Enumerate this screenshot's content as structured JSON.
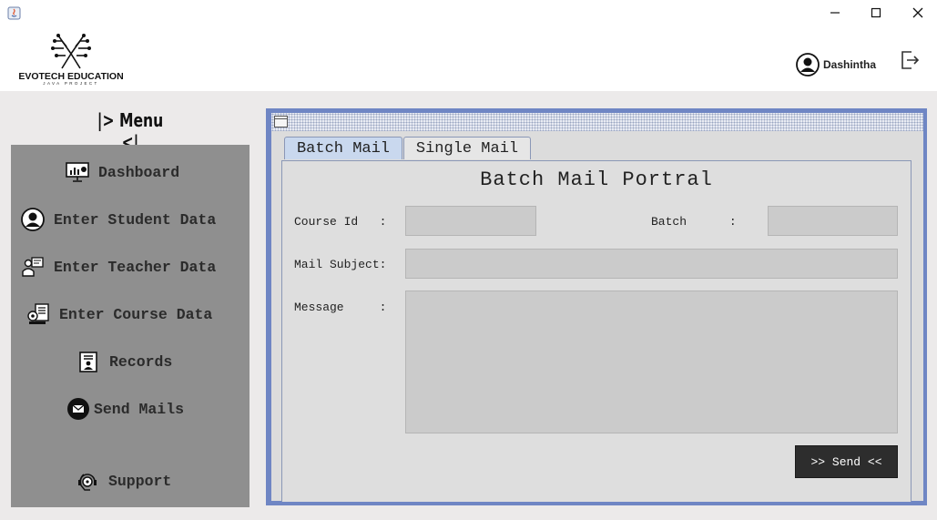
{
  "window": {
    "minimize_label": "minimize",
    "maximize_label": "maximize",
    "close_label": "close"
  },
  "header": {
    "logo_title": "EVOTECH EDUCATION",
    "logo_subtitle": "JAVA PROJECT",
    "user_name": "Dashintha"
  },
  "sidebar": {
    "title": "|> Menu <|",
    "items": [
      {
        "label": "Dashboard",
        "icon": "dashboard-icon"
      },
      {
        "label": "Enter Student Data",
        "icon": "student-icon"
      },
      {
        "label": "Enter Teacher Data",
        "icon": "teacher-icon"
      },
      {
        "label": "Enter Course Data",
        "icon": "course-icon"
      },
      {
        "label": "Records",
        "icon": "records-icon"
      },
      {
        "label": "Send Mails",
        "icon": "mail-icon"
      },
      {
        "label": "Support",
        "icon": "support-icon"
      }
    ]
  },
  "tabs": [
    {
      "label": "Batch Mail",
      "active": true
    },
    {
      "label": "Single Mail",
      "active": false
    }
  ],
  "form": {
    "title": "Batch Mail Portral",
    "course_id_label": "Course Id   :",
    "course_id_value": "",
    "batch_label": "Batch      :",
    "batch_value": "",
    "subject_label": "Mail Subject:",
    "subject_value": "",
    "message_label": "Message     :",
    "message_value": "",
    "send_label": ">> Send <<"
  },
  "colors": {
    "sidebar_bg": "#8f8f8f",
    "frame_border": "#6f86c4",
    "active_tab": "#c9d8ee",
    "send_button": "#2d2d2d"
  }
}
